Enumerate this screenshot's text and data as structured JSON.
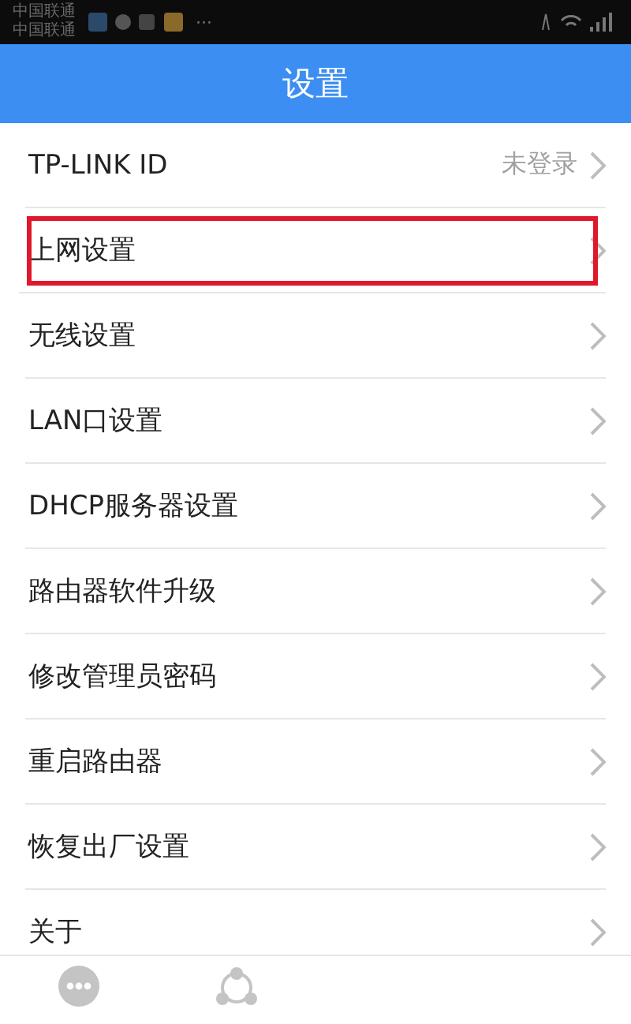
{
  "status_bar": {
    "carriers": [
      "中国联通",
      "中国联通"
    ],
    "more": "···"
  },
  "header": {
    "title": "设置"
  },
  "items": [
    {
      "label": "TP-LINK ID",
      "value": "未登录",
      "highlighted": false
    },
    {
      "label": "上网设置",
      "highlighted": true
    },
    {
      "label": "无线设置",
      "highlighted": false
    },
    {
      "label": "LAN口设置",
      "highlighted": false
    },
    {
      "label": "DHCP服务器设置",
      "highlighted": false
    },
    {
      "label": "路由器软件升级",
      "highlighted": false
    },
    {
      "label": "修改管理员密码",
      "highlighted": false
    },
    {
      "label": "重启路由器",
      "highlighted": false
    },
    {
      "label": "恢复出厂设置",
      "highlighted": false
    },
    {
      "label": "关于",
      "highlighted": false
    }
  ],
  "tab_bar": [
    {
      "kind": "more"
    },
    {
      "kind": "share"
    }
  ]
}
